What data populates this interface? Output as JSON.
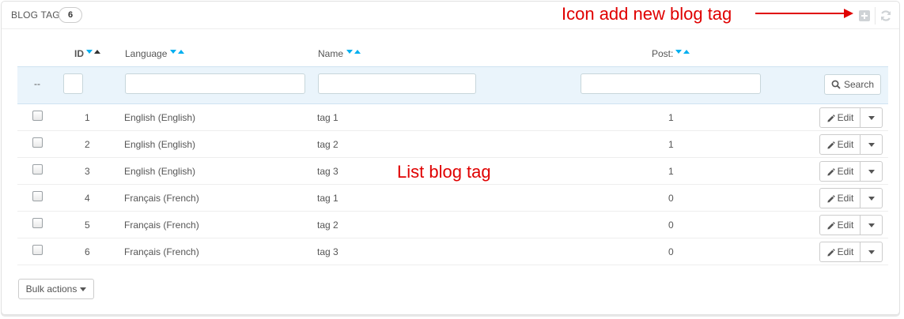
{
  "header": {
    "title": "BLOG TAG",
    "count": "6",
    "annotation": "Icon add new blog tag",
    "icons": [
      "add-icon",
      "refresh-icon"
    ]
  },
  "columns": {
    "select": "--",
    "id": "ID",
    "language": "Language",
    "name": "Name",
    "post": "Post:"
  },
  "search": {
    "label": "Search"
  },
  "rows": [
    {
      "id": "1",
      "language": "English (English)",
      "name": "tag 1",
      "post": "1",
      "edit": "Edit"
    },
    {
      "id": "2",
      "language": "English (English)",
      "name": "tag 2",
      "post": "1",
      "edit": "Edit"
    },
    {
      "id": "3",
      "language": "English (English)",
      "name": "tag 3",
      "post": "1",
      "edit": "Edit"
    },
    {
      "id": "4",
      "language": "Français (French)",
      "name": "tag 1",
      "post": "0",
      "edit": "Edit"
    },
    {
      "id": "5",
      "language": "Français (French)",
      "name": "tag 2",
      "post": "0",
      "edit": "Edit"
    },
    {
      "id": "6",
      "language": "Français (French)",
      "name": "tag 3",
      "post": "0",
      "edit": "Edit"
    }
  ],
  "list_annotation": "List blog tag",
  "bulk": {
    "label": "Bulk actions"
  },
  "colors": {
    "annotation": "#e00000",
    "sort_active": "#00aff0",
    "filter_bg": "#eaf4fb"
  }
}
